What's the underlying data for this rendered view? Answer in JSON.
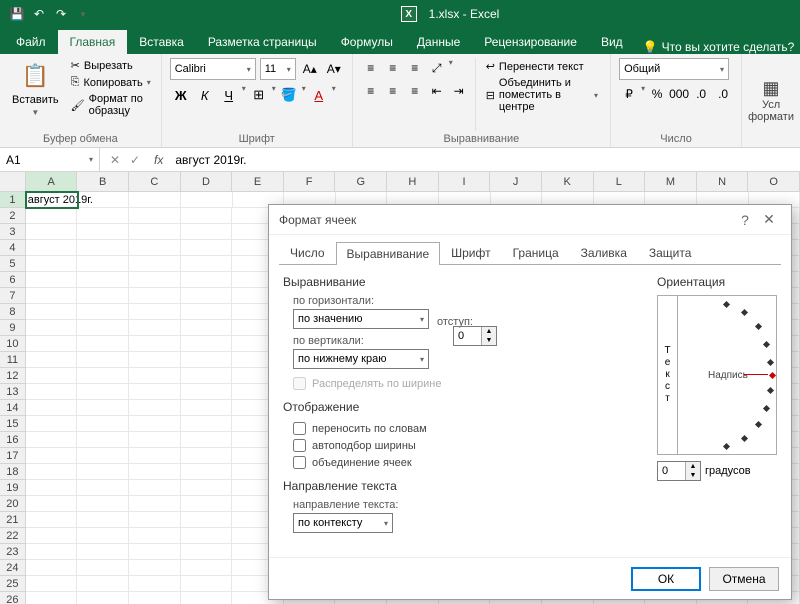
{
  "app": {
    "title": "1.xlsx - Excel"
  },
  "tabs": {
    "file": "Файл",
    "home": "Главная",
    "insert": "Вставка",
    "pagelayout": "Разметка страницы",
    "formulas": "Формулы",
    "data": "Данные",
    "review": "Рецензирование",
    "view": "Вид",
    "tellme": "Что вы хотите сделать?"
  },
  "ribbon": {
    "clipboard": {
      "paste": "Вставить",
      "cut": "Вырезать",
      "copy": "Копировать",
      "format_painter": "Формат по образцу",
      "label": "Буфер обмена"
    },
    "font": {
      "name": "Calibri",
      "size": "11",
      "label": "Шрифт"
    },
    "alignment": {
      "wrap": "Перенести текст",
      "merge": "Объединить и поместить в центре",
      "label": "Выравнивание"
    },
    "number": {
      "format": "Общий",
      "label": "Число"
    },
    "last": {
      "line1": "Усл",
      "line2": "формати"
    }
  },
  "namebox": "A1",
  "formula": "август 2019г.",
  "columns": [
    "A",
    "B",
    "C",
    "D",
    "E",
    "F",
    "G",
    "H",
    "I",
    "J",
    "K",
    "L",
    "M",
    "N",
    "O"
  ],
  "cell_a1": "август 2019г.",
  "dialog": {
    "title": "Формат ячеек",
    "tabs": {
      "number": "Число",
      "alignment": "Выравнивание",
      "font": "Шрифт",
      "border": "Граница",
      "fill": "Заливка",
      "protection": "Защита"
    },
    "sections": {
      "alignment": "Выравнивание",
      "display": "Отображение",
      "textdir": "Направление текста",
      "orientation": "Ориентация"
    },
    "labels": {
      "horiz": "по горизонтали:",
      "vert": "по вертикали:",
      "indent": "отступ:",
      "distribute": "Распределять по ширине",
      "wrap": "переносить по словам",
      "autofit": "автоподбор ширины",
      "mergecells": "объединение ячеек",
      "textdir": "направление текста:",
      "degrees": "градусов",
      "vtext": "Текст",
      "diallabel": "Надпись"
    },
    "values": {
      "horiz": "по значению",
      "vert": "по нижнему краю",
      "indent": "0",
      "textdir": "по контексту",
      "degrees": "0"
    },
    "buttons": {
      "ok": "ОК",
      "cancel": "Отмена"
    }
  }
}
